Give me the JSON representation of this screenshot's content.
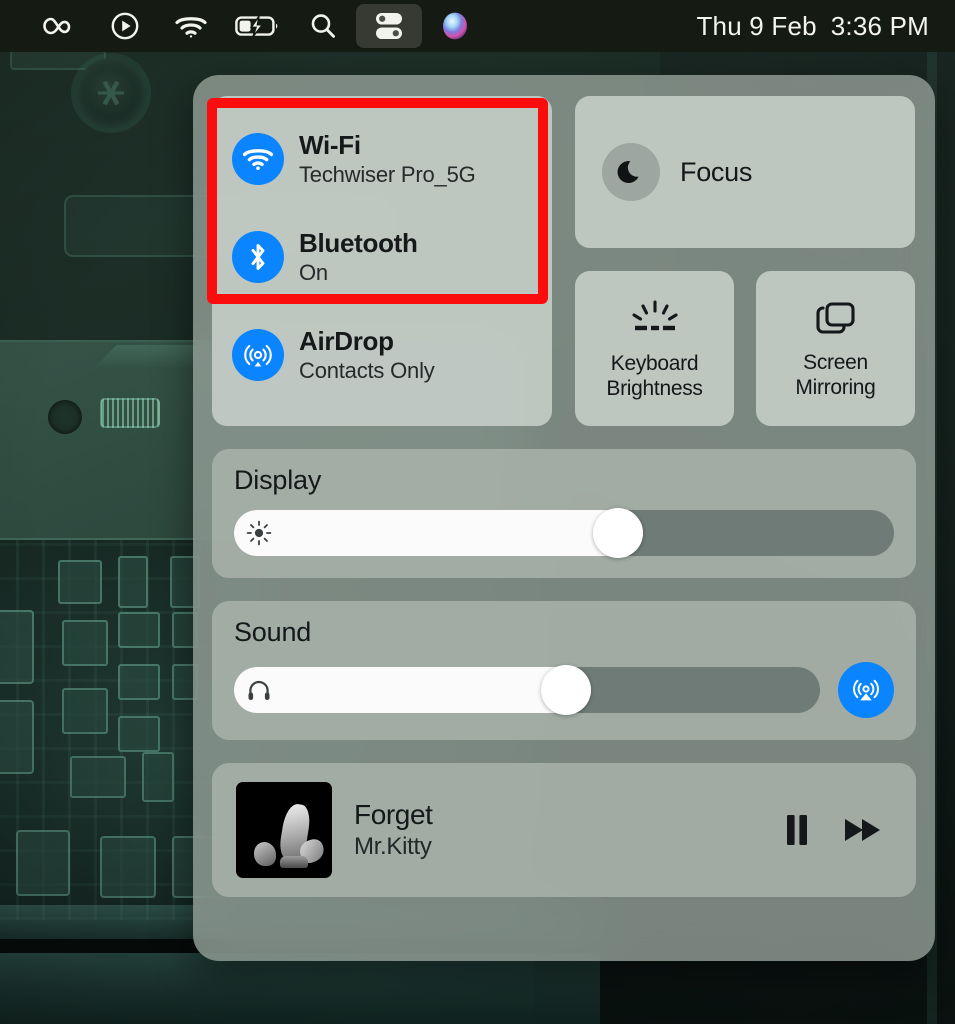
{
  "menubar": {
    "icons": [
      {
        "name": "infinity-icon",
        "label": "Infinity"
      },
      {
        "name": "play-circle-icon",
        "label": "Play"
      },
      {
        "name": "wifi-icon",
        "label": "Wi-Fi"
      },
      {
        "name": "battery-charging-icon",
        "label": "Battery Charging"
      },
      {
        "name": "search-icon",
        "label": "Spotlight Search"
      },
      {
        "name": "control-center-icon",
        "label": "Control Center"
      },
      {
        "name": "siri-icon",
        "label": "Siri"
      }
    ],
    "date": "Thu 9 Feb",
    "time": "3:36 PM"
  },
  "control_center": {
    "connectivity": [
      {
        "icon": "wifi-icon",
        "title": "Wi-Fi",
        "subtitle": "Techwiser Pro_5G",
        "enabled": true
      },
      {
        "icon": "bluetooth-icon",
        "title": "Bluetooth",
        "subtitle": "On",
        "enabled": true
      },
      {
        "icon": "airdrop-icon",
        "title": "AirDrop",
        "subtitle": "Contacts Only",
        "enabled": true
      }
    ],
    "focus": {
      "icon": "moon-icon",
      "label": "Focus"
    },
    "tiles": [
      {
        "icon": "keyboard-brightness-icon",
        "line1": "Keyboard",
        "line2": "Brightness"
      },
      {
        "icon": "screen-mirroring-icon",
        "line1": "Screen",
        "line2": "Mirroring"
      }
    ],
    "display": {
      "title": "Display",
      "icon": "brightness-sun-icon",
      "value_percent": 62
    },
    "sound": {
      "title": "Sound",
      "icon": "headphones-icon",
      "value_percent": 61,
      "airplay_icon": "airplay-audio-icon"
    },
    "media": {
      "title": "Forget",
      "artist": "Mr.Kitty",
      "album_art": "album-artwork",
      "pause_icon": "pause-icon",
      "forward_icon": "fast-forward-icon"
    }
  },
  "annotation": {
    "color": "#fb0d0d",
    "name": "highlight-wifi-bluetooth"
  },
  "colors": {
    "accent_blue": "#0a84ff",
    "panel_bg": "rgba(148,160,152,0.80)",
    "tile_bg": "rgba(196,204,198,0.92)",
    "menubar_bg": "#151a12"
  }
}
